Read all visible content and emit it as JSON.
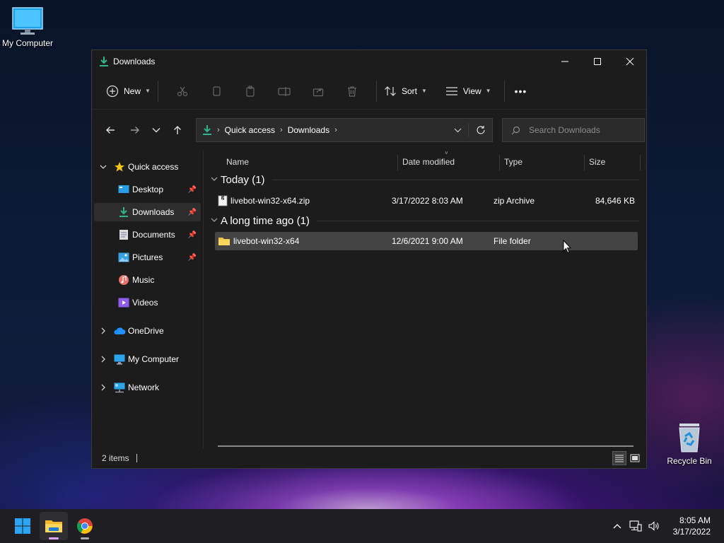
{
  "desktop": {
    "icons": [
      {
        "label": "My Computer",
        "icon": "computer-icon"
      },
      {
        "label": "Recycle Bin",
        "icon": "recycle-bin-icon"
      }
    ]
  },
  "window": {
    "title": "Downloads",
    "accent": "#2fb68e"
  },
  "commandbar": {
    "new_label": "New",
    "sort_label": "Sort",
    "view_label": "View",
    "more_label": "•••"
  },
  "address": {
    "crumbs": [
      "Quick access",
      "Downloads"
    ],
    "search_placeholder": "Search Downloads"
  },
  "sidebar": {
    "items": [
      {
        "label": "Quick access",
        "icon": "star-icon"
      },
      {
        "label": "Desktop",
        "icon": "desktop-icon"
      },
      {
        "label": "Downloads",
        "icon": "download-icon"
      },
      {
        "label": "Documents",
        "icon": "documents-icon"
      },
      {
        "label": "Pictures",
        "icon": "pictures-icon"
      },
      {
        "label": "Music",
        "icon": "music-icon"
      },
      {
        "label": "Videos",
        "icon": "videos-icon"
      },
      {
        "label": "OneDrive",
        "icon": "cloud-icon"
      },
      {
        "label": "My Computer",
        "icon": "computer-icon"
      },
      {
        "label": "Network",
        "icon": "network-icon"
      }
    ]
  },
  "columns": {
    "name": "Name",
    "date": "Date modified",
    "type": "Type",
    "size": "Size"
  },
  "groups": [
    {
      "title": "Today (1)",
      "files": [
        {
          "name": "livebot-win32-x64.zip",
          "date": "3/17/2022 8:03 AM",
          "type": "zip Archive",
          "size": "84,646 KB",
          "icon": "zip-file-icon"
        }
      ]
    },
    {
      "title": "A long time ago (1)",
      "files": [
        {
          "name": "livebot-win32-x64",
          "date": "12/6/2021 9:00 AM",
          "type": "File folder",
          "size": "",
          "icon": "folder-icon"
        }
      ]
    }
  ],
  "status": {
    "items_count": "2 items"
  },
  "taskbar": {
    "time": "8:05 AM",
    "date": "3/17/2022"
  }
}
